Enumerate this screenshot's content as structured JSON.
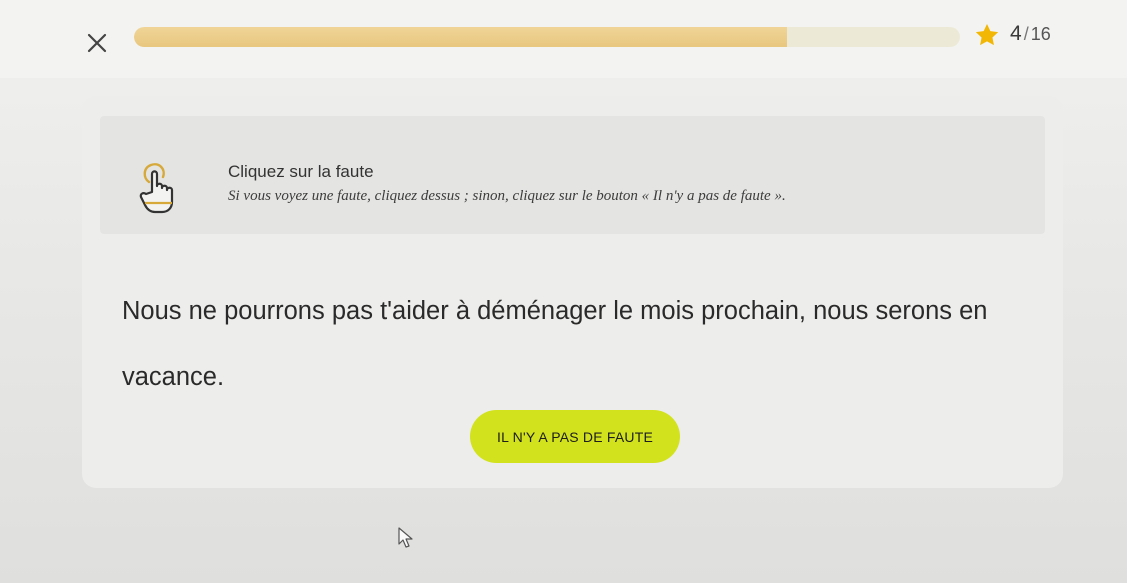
{
  "header": {
    "close_icon": "close-icon",
    "progress": {
      "fraction": 0.79
    },
    "star_icon": "star-icon",
    "counter": {
      "current": "4",
      "separator": "/",
      "total": "16"
    }
  },
  "instructions": {
    "icon": "pointing-hand-icon",
    "title": "Cliquez sur la faute",
    "subtitle": "Si vous voyez une faute, cliquez dessus ; sinon, cliquez sur le bouton « Il n'y a pas de faute »."
  },
  "exercise": {
    "words": [
      "Nous",
      "ne",
      "pourrons",
      "pas",
      "t'aider",
      "à",
      "déménager",
      "le",
      "mois",
      "prochain,",
      "nous",
      "serons",
      "en",
      "vacance."
    ]
  },
  "actions": {
    "no_fault_label": "IL N'Y A PAS DE FAUTE"
  },
  "colors": {
    "accent_button": "#d2e21c",
    "progress_fill": "#e8c77e",
    "star": "#f2b705"
  }
}
